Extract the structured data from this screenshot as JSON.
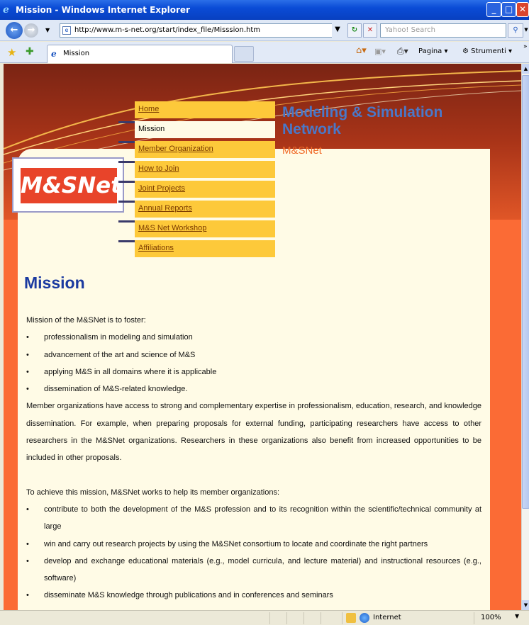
{
  "window": {
    "title": "Mission - Windows Internet Explorer"
  },
  "toolbar": {
    "url": "http://www.m-s-net.org/start/index_file/Misssion.htm",
    "search_placeholder": "Yahoo! Search",
    "tab_label": "Mission",
    "page_menu": "Pagina",
    "tools_menu": "Strumenti"
  },
  "site": {
    "title": "Modeling & Simulation Network",
    "subtitle": "M&SNet",
    "logo_text": "M&SNet",
    "menu": [
      {
        "label": "Home",
        "active": false
      },
      {
        "label": "Mission",
        "active": true
      },
      {
        "label": "Member Organization",
        "active": false
      },
      {
        "label": "How to Join",
        "active": false
      },
      {
        "label": "Joint Projects",
        "active": false
      },
      {
        "label": "Annual Reports",
        "active": false
      },
      {
        "label": "M&S Net Workshop",
        "active": false
      },
      {
        "label": "Affiliations",
        "active": false
      }
    ]
  },
  "content": {
    "heading": "Mission",
    "intro": "Mission of the M&SNet is to foster:",
    "goals": [
      "professionalism in modeling and simulation",
      "advancement of the art and science of M&S",
      "applying M&S in all domains where it is applicable",
      "dissemination of M&S-related knowledge."
    ],
    "paragraph": "Member organizations have access to strong and complementary expertise in professionalism, education, research, and knowledge dissemination. For example, when preparing proposals for external funding, participating researchers have access to other researchers in the M&SNet organizations. Researchers in these organizations also benefit from increased opportunities to be included in other proposals.",
    "achieve_intro": "To achieve this mission, M&SNet works to help its member organizations:",
    "actions": [
      "contribute to both the development of the M&S profession and to its recognition within the scientific/technical community at large",
      "win and carry out research projects by using the M&SNet consortium to locate and coordinate the right partners",
      "develop and exchange educational materials (e.g., model curricula, and lecture material) and instructional resources (e.g., software)",
      "disseminate M&S knowledge through publications and in conferences and seminars"
    ]
  },
  "status": {
    "zone": "Internet",
    "zoom": "100%"
  }
}
